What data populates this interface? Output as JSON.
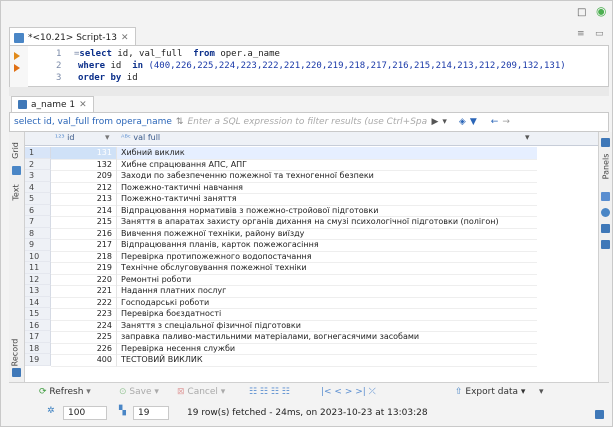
{
  "window": {
    "tab_title": "*<10.21> Script-13",
    "minimize_icon": "minimize-icon",
    "maximize_icon": "maximize-icon"
  },
  "editor": {
    "lines": [
      {
        "num": "1",
        "prefix": "=",
        "kw1": "select",
        "rest1": " id, val_full  ",
        "kw2": "from",
        "rest2": " oper.a_name"
      },
      {
        "num": "2",
        "kw1": "where",
        "rest1": " id  ",
        "kw2": "in",
        "rest2": " (400,226,225,224,223,222,221,220,219,218,217,216,215,214,213,212,209,132,131)"
      },
      {
        "num": "3",
        "kw1": "order by",
        "rest1": " id"
      }
    ]
  },
  "results": {
    "tab_label": "a_name 1",
    "filter_query": "select id, val_full from opera_name",
    "filter_placeholder": "Enter a SQL expression to filter results (use Ctrl+Space)",
    "side_labels": {
      "grid": "Grid",
      "text": "Text",
      "record": "Record",
      "panels": "Panels"
    },
    "columns": {
      "id": "id",
      "val": "val full"
    },
    "rows": [
      {
        "n": "1",
        "id": "131",
        "val": "Хибний виклик"
      },
      {
        "n": "2",
        "id": "132",
        "val": "Хибне спрацювання АПС, АПГ"
      },
      {
        "n": "3",
        "id": "209",
        "val": "Заходи по забезпеченню пожежної та техногенної безпеки"
      },
      {
        "n": "4",
        "id": "212",
        "val": "Пожежно-тактичні навчання"
      },
      {
        "n": "5",
        "id": "213",
        "val": "Пожежно-тактичні заняття"
      },
      {
        "n": "6",
        "id": "214",
        "val": "Відпрацювання нормативів з пожежно-стройової підготовки"
      },
      {
        "n": "7",
        "id": "215",
        "val": "Заняття в апаратах захисту органів дихання на смузі психологічної підготовки (полігон)"
      },
      {
        "n": "8",
        "id": "216",
        "val": "Вивчення пожежної техніки, району виїзду"
      },
      {
        "n": "9",
        "id": "217",
        "val": "Відпрацювання планів, карток пожежогасіння"
      },
      {
        "n": "10",
        "id": "218",
        "val": "Перевірка протипожежного водопостачання"
      },
      {
        "n": "11",
        "id": "219",
        "val": "Технічне обслуговування пожежної техніки"
      },
      {
        "n": "12",
        "id": "220",
        "val": "Ремонтні роботи"
      },
      {
        "n": "13",
        "id": "221",
        "val": "Надання платних послуг"
      },
      {
        "n": "14",
        "id": "222",
        "val": "Господарські роботи"
      },
      {
        "n": "15",
        "id": "223",
        "val": "Перевірка боєздатності"
      },
      {
        "n": "16",
        "id": "224",
        "val": "Заняття з спеціальної фізичної підготовки"
      },
      {
        "n": "17",
        "id": "225",
        "val": "заправка паливо-мастильними матеріалами, вогнегасячими засобами"
      },
      {
        "n": "18",
        "id": "226",
        "val": "Перевірка несення служби"
      },
      {
        "n": "19",
        "id": "400",
        "val": "ТЕСТОВИЙ ВИКЛИК"
      }
    ]
  },
  "toolbar": {
    "refresh": "Refresh",
    "save": "Save",
    "cancel": "Cancel",
    "export": "Export data"
  },
  "status": {
    "fetch_size": "100",
    "row_count": "19",
    "message": "19 row(s) fetched - 24ms, on 2023-10-23 at 13:03:28"
  }
}
